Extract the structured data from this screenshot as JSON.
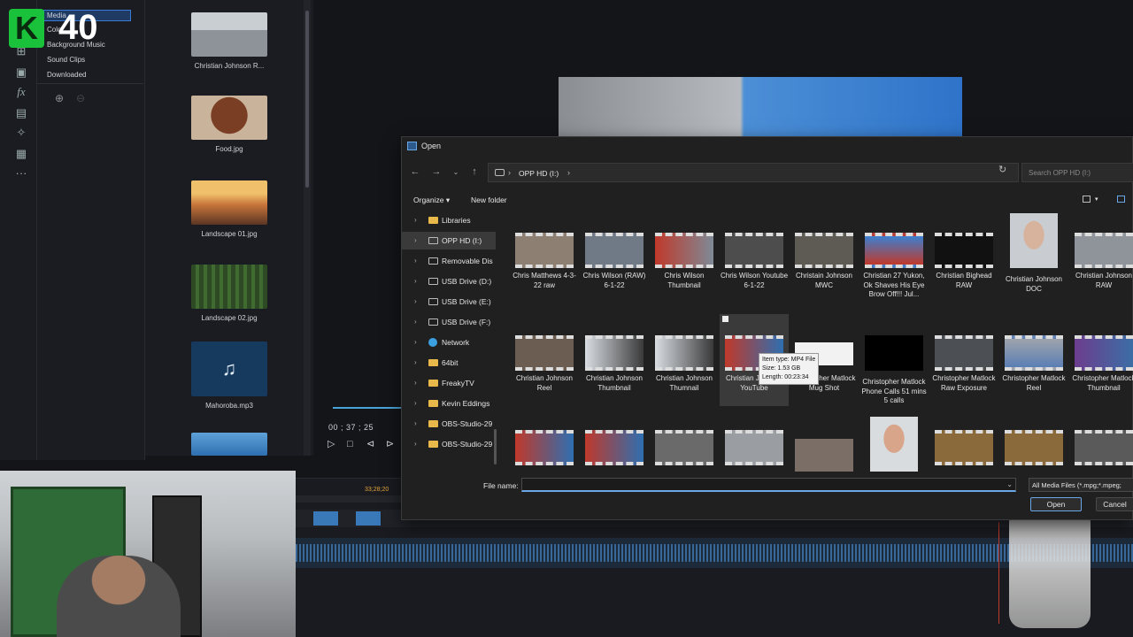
{
  "overlay": {
    "badge_letter": "K",
    "badge_number": "40"
  },
  "media_tree": {
    "items": [
      "Media",
      "Color",
      "Background Music",
      "Sound Clips",
      "Downloaded"
    ]
  },
  "media_library": {
    "items": [
      {
        "label": "Christian Johnson R...",
        "thumb_color": "#9aa3ab"
      },
      {
        "label": "Food.jpg",
        "thumb_color": "#8b5a3c"
      },
      {
        "label": "Landscape 01.jpg",
        "thumb_color": "#c98a4a"
      },
      {
        "label": "Landscape 02.jpg",
        "thumb_color": "#2f5a2c"
      },
      {
        "label": "Mahoroba.mp3",
        "thumb_color": "#163a5e"
      },
      {
        "label": "",
        "thumb_color": "#3d7ab8"
      }
    ]
  },
  "player": {
    "timecode": "00 ; 37 ; 25",
    "ruler_time": "33;28;20"
  },
  "dialog": {
    "title": "Open",
    "address": "OPP HD (I:)",
    "search_placeholder": "Search OPP HD (I:)",
    "organize": "Organize ▾",
    "new_folder": "New folder",
    "nav_items": [
      {
        "label": "Libraries",
        "icon": "library-icon"
      },
      {
        "label": "OPP HD (I:)",
        "icon": "drive-icon"
      },
      {
        "label": "Removable Dis",
        "icon": "drive-icon"
      },
      {
        "label": "USB Drive (D:)",
        "icon": "drive-icon"
      },
      {
        "label": "USB Drive (E:)",
        "icon": "drive-icon"
      },
      {
        "label": "USB Drive (F:)",
        "icon": "drive-icon"
      },
      {
        "label": "Network",
        "icon": "network-icon"
      },
      {
        "label": "64bit",
        "icon": "folder-icon"
      },
      {
        "label": "FreakyTV",
        "icon": "folder-icon"
      },
      {
        "label": "Kevin Eddings",
        "icon": "folder-icon"
      },
      {
        "label": "OBS-Studio-29",
        "icon": "folder-icon"
      },
      {
        "label": "OBS-Studio-29",
        "icon": "folder-icon"
      }
    ],
    "files_row1": [
      "Chris Matthews 4-3-22 raw",
      "Chris Wilson (RAW) 6-1-22",
      "Chris Wilson Thumbnail",
      "Chris Wilson Youtube 6-1-22",
      "Christain Johnson MWC",
      "Christian 27 Yukon, Ok Shaves His Eye Brow Off!!! Jul...",
      "Christian Bighead RAW",
      "Christian Johnson DOC",
      "Christian Johnson RAW"
    ],
    "files_row2": [
      "Christian Johnson Reel",
      "Christian Johnson Thumbnail",
      "Christian Johnson Thumnail",
      "Christian Johnson YouTube",
      "Christopher Matlock Mug Shot",
      "Christopher Matlock Phone Calls 51 mins 5 calls",
      "Christopher Matlock Raw Exposure",
      "Christopher Matlock Reel",
      "Christopher Matlock Thumbnail"
    ],
    "tooltip": {
      "type": "Item type: MP4 File",
      "size": "Size: 1.53 GB",
      "length": "Length: 00:23:34"
    },
    "file_name_label": "File name:",
    "file_name_value": "",
    "file_type": "All Media Files (*.mpg;*.mpeg;",
    "open_button": "Open",
    "cancel_button": "Cancel"
  }
}
